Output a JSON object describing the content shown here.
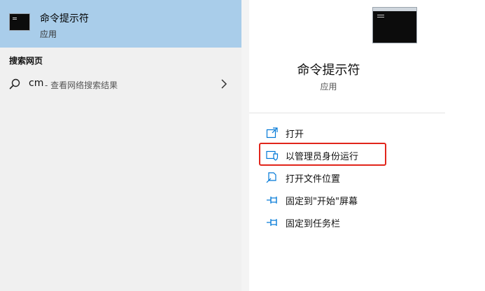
{
  "best_match": {
    "title": "命令提示符",
    "subtitle": "应用",
    "icon": "terminal-icon"
  },
  "web_section": {
    "label": "搜索网页",
    "query": "cm",
    "suffix": " - 查看网络搜索结果"
  },
  "details": {
    "app_name": "命令提示符",
    "app_type": "应用",
    "icon": "terminal-icon"
  },
  "actions": [
    {
      "label": "打开",
      "icon": "open-icon"
    },
    {
      "label": "以管理员身份运行",
      "icon": "shield-icon"
    },
    {
      "label": "打开文件位置",
      "icon": "file-location-icon"
    },
    {
      "label": "固定到\"开始\"屏幕",
      "icon": "pin-icon"
    },
    {
      "label": "固定到任务栏",
      "icon": "pin-icon"
    }
  ],
  "colors": {
    "selection": "#a9cdea",
    "accent": "#0078d7",
    "highlight": "#e1251b"
  }
}
